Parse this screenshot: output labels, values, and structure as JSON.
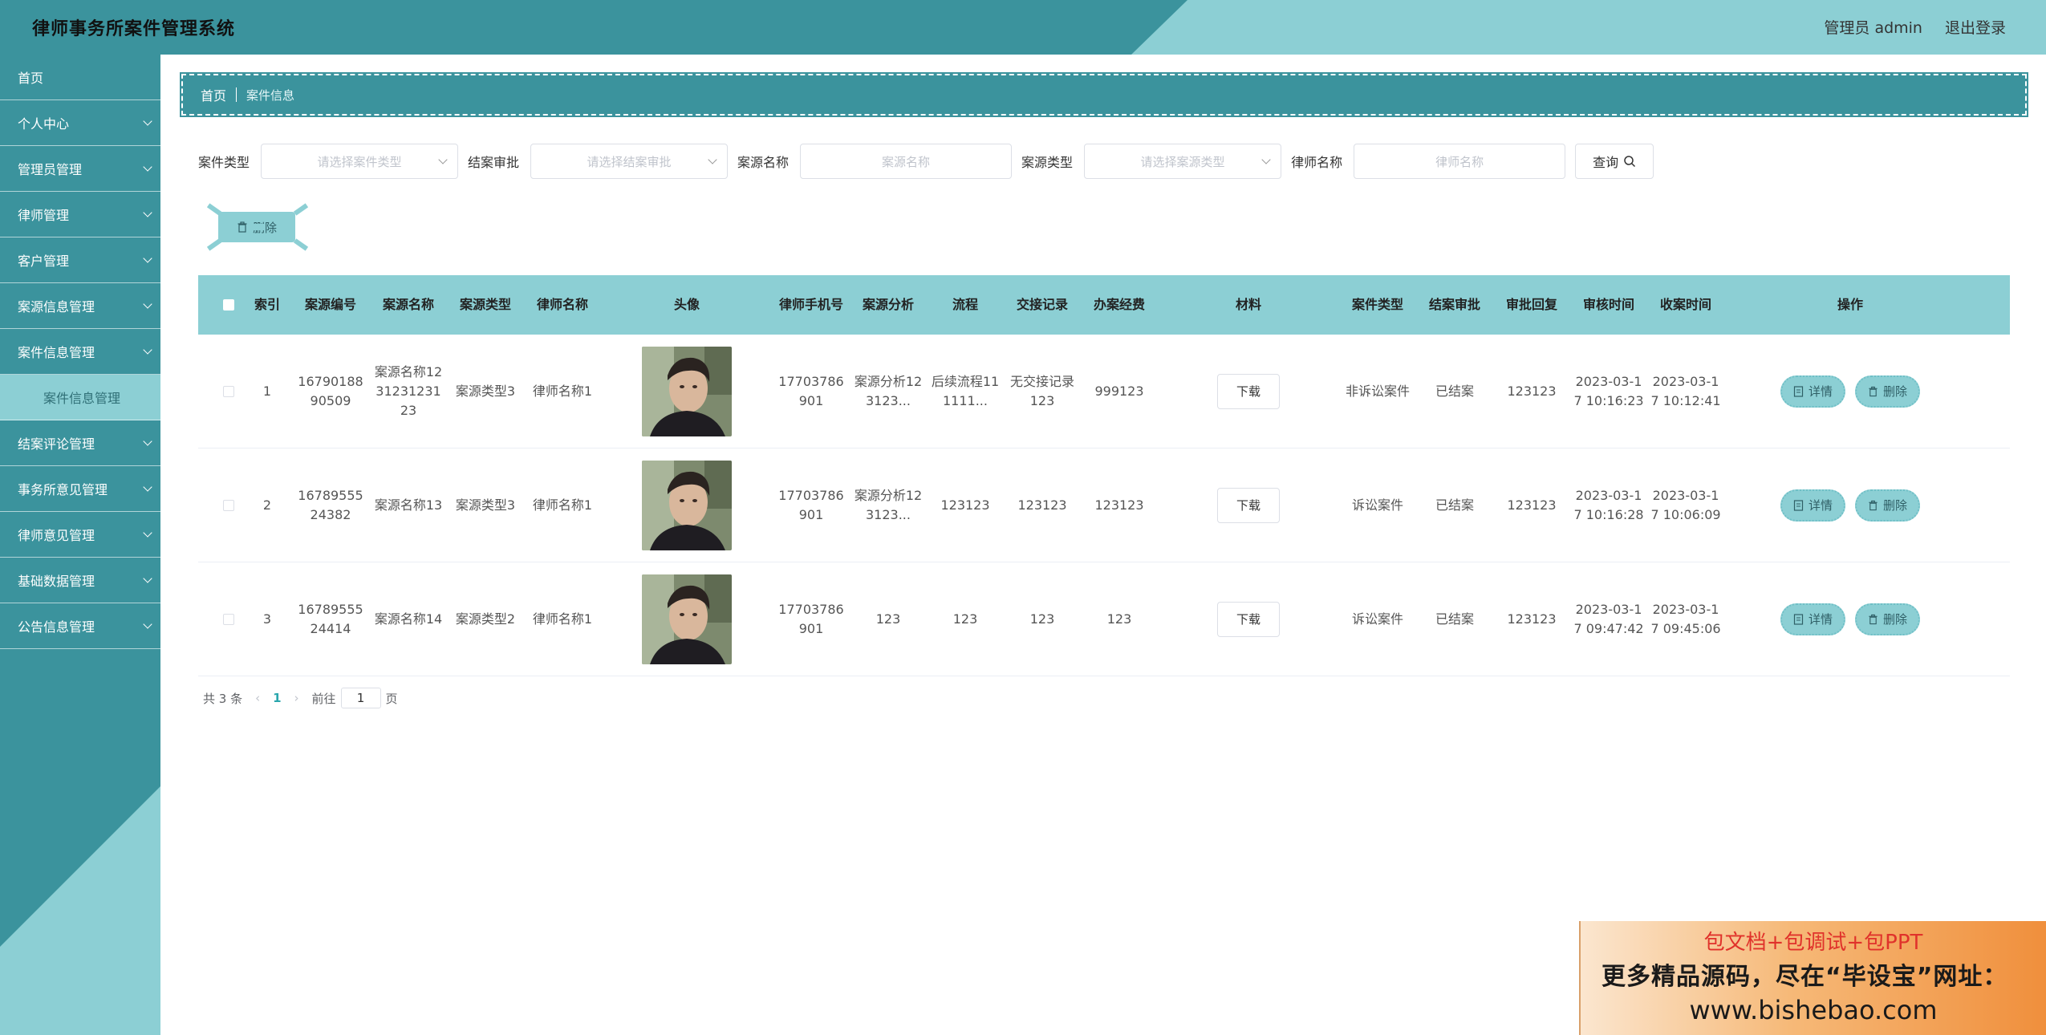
{
  "header": {
    "app_title": "律师事务所案件管理系统",
    "user_label": "管理员 admin",
    "logout_label": "退出登录"
  },
  "sidebar": {
    "items": [
      {
        "label": "首页",
        "has_arrow": false
      },
      {
        "label": "个人中心",
        "has_arrow": true
      },
      {
        "label": "管理员管理",
        "has_arrow": true
      },
      {
        "label": "律师管理",
        "has_arrow": true
      },
      {
        "label": "客户管理",
        "has_arrow": true
      },
      {
        "label": "案源信息管理",
        "has_arrow": true
      },
      {
        "label": "案件信息管理",
        "has_arrow": true
      },
      {
        "label": "案件信息管理",
        "has_arrow": false,
        "sub": true
      },
      {
        "label": "结案评论管理",
        "has_arrow": true
      },
      {
        "label": "事务所意见管理",
        "has_arrow": true
      },
      {
        "label": "律师意见管理",
        "has_arrow": true
      },
      {
        "label": "基础数据管理",
        "has_arrow": true
      },
      {
        "label": "公告信息管理",
        "has_arrow": true
      }
    ]
  },
  "breadcrumb": {
    "home": "首页",
    "current": "案件信息"
  },
  "filters": {
    "case_type_label": "案件类型",
    "case_type_placeholder": "请选择案件类型",
    "close_approval_label": "结案审批",
    "close_approval_placeholder": "请选择结案审批",
    "source_name_label": "案源名称",
    "source_name_placeholder": "案源名称",
    "source_type_label": "案源类型",
    "source_type_placeholder": "请选择案源类型",
    "lawyer_name_label": "律师名称",
    "lawyer_name_placeholder": "律师名称",
    "query_label": "查询"
  },
  "toolbar": {
    "delete_label": "删除"
  },
  "table": {
    "headers": [
      "索引",
      "案源编号",
      "案源名称",
      "案源类型",
      "律师名称",
      "头像",
      "律师手机号",
      "案源分析",
      "流程",
      "交接记录",
      "办案经费",
      "材料",
      "案件类型",
      "结案审批",
      "审批回复",
      "审核时间",
      "收案时间",
      "操作"
    ],
    "rows": [
      {
        "index": "1",
        "source_no": "1679018890509",
        "source_name": "案源名称123123123123",
        "source_type": "案源类型3",
        "lawyer_name": "律师名称1",
        "phone": "17703786901",
        "analysis": "案源分析123123...",
        "process": "后续流程111111...",
        "handover": "无交接记录123",
        "funds": "999123",
        "material": "下载",
        "case_type": "非诉讼案件",
        "approval": "已结案",
        "reply": "123123",
        "review_time": "2023-03-17 10:16:23",
        "accept_time": "2023-03-17 10:12:41"
      },
      {
        "index": "2",
        "source_no": "1678955524382",
        "source_name": "案源名称13",
        "source_type": "案源类型3",
        "lawyer_name": "律师名称1",
        "phone": "17703786901",
        "analysis": "案源分析123123...",
        "process": "123123",
        "handover": "123123",
        "funds": "123123",
        "material": "下载",
        "case_type": "诉讼案件",
        "approval": "已结案",
        "reply": "123123",
        "review_time": "2023-03-17 10:16:28",
        "accept_time": "2023-03-17 10:06:09"
      },
      {
        "index": "3",
        "source_no": "1678955524414",
        "source_name": "案源名称14",
        "source_type": "案源类型2",
        "lawyer_name": "律师名称1",
        "phone": "17703786901",
        "analysis": "123",
        "process": "123",
        "handover": "123",
        "funds": "123",
        "material": "下载",
        "case_type": "诉讼案件",
        "approval": "已结案",
        "reply": "123123",
        "review_time": "2023-03-17 09:47:42",
        "accept_time": "2023-03-17 09:45:06"
      }
    ],
    "detail_label": "详情",
    "delete_label": "删除"
  },
  "pagination": {
    "total": "共 3 条",
    "current_page": "1",
    "goto_label": "前往",
    "goto_value": "1",
    "page_unit": "页"
  },
  "promo": {
    "line1": "包文档+包调试+包PPT",
    "line2": "更多精品源码，尽在“毕设宝”网址：",
    "line3": "www.bishebao.com"
  },
  "colors": {
    "primary": "#3b939d",
    "light": "#8ccfd4"
  }
}
